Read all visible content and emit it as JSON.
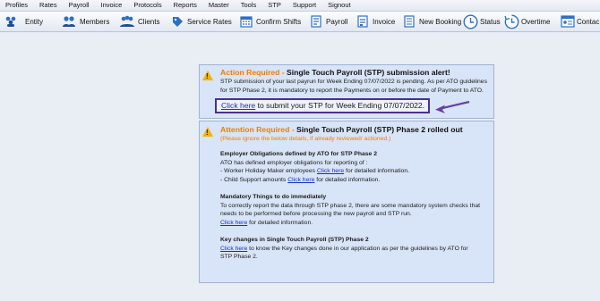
{
  "menu": [
    "Profiles",
    "Rates",
    "Payroll",
    "Invoice",
    "Protocols",
    "Reports",
    "Master",
    "Tools",
    "STP",
    "Support",
    "Signout"
  ],
  "toolbar": {
    "entity": "Entity",
    "members": "Members",
    "clients": "Clients",
    "service_rates": "Service Rates",
    "confirm_shifts": "Confirm Shifts",
    "payroll": "Payroll",
    "invoice": "Invoice",
    "new_booking": "New Booking",
    "status": "Status",
    "overtime": "Overtime",
    "contact": "Contac"
  },
  "alert1": {
    "prefix": "Action Required -",
    "title": "Single Touch Payroll (STP) submission alert!",
    "line1": "STP submission of your last payrun for Week Ending 07/07/2022 is pending. As per ATO guidelines",
    "line2": "for STP Phase 2, it is mandatory to report the Payments on or before the date of Payment to ATO.",
    "link": "Click  here",
    "link_rest": " to submit your STP for Week Ending 07/07/2022."
  },
  "alert2": {
    "prefix": "Attention Required -",
    "title": "Single Touch Payroll (STP) Phase 2 rolled out",
    "note": "(Please ignore the below details, if already reviewed/ actioned.)",
    "sec1_head": "Employer Obligations defined by ATO for STP Phase 2",
    "sec1_line1": "ATO has defined employer obligations for reporting of :",
    "sec1_line2_pre": "- Worker Holiday Maker employees ",
    "sec1_line2_link": "Click here",
    "sec1_line2_post": " for detailed information.",
    "sec1_line3_pre": "- Child Support amounts  ",
    "sec1_line3_link": "Click here",
    "sec1_line3_post": " for detailed information.",
    "sec2_head": "Mandatory Things to do immediately",
    "sec2_line1": "To correctly report the data through STP phase 2, there are some mandatory system checks that",
    "sec2_line2": "needs to be performed before processing the new payroll and STP run.",
    "sec2_link": "Click here",
    "sec2_post": " for detailed information.",
    "sec3_head": "Key changes in Single Touch Payroll (STP) Phase 2",
    "sec3_link": "Click here",
    "sec3_post": " to know the Key changes done in our application as per the guidelines by ATO for",
    "sec3_line2": "STP Phase 2."
  },
  "colors": {
    "accent_orange": "#ef7d00",
    "link_blue": "#1530c8",
    "highlight_purple": "#4b2f8f",
    "card_bg": "#d8e4f7"
  },
  "icons": [
    "entity-icon",
    "members-icon",
    "clients-icon",
    "service-rates-icon",
    "confirm-shifts-icon",
    "payroll-icon",
    "invoice-icon",
    "new-booking-icon",
    "status-icon",
    "overtime-icon",
    "contact-icon",
    "warning-icon",
    "arrow-icon"
  ]
}
